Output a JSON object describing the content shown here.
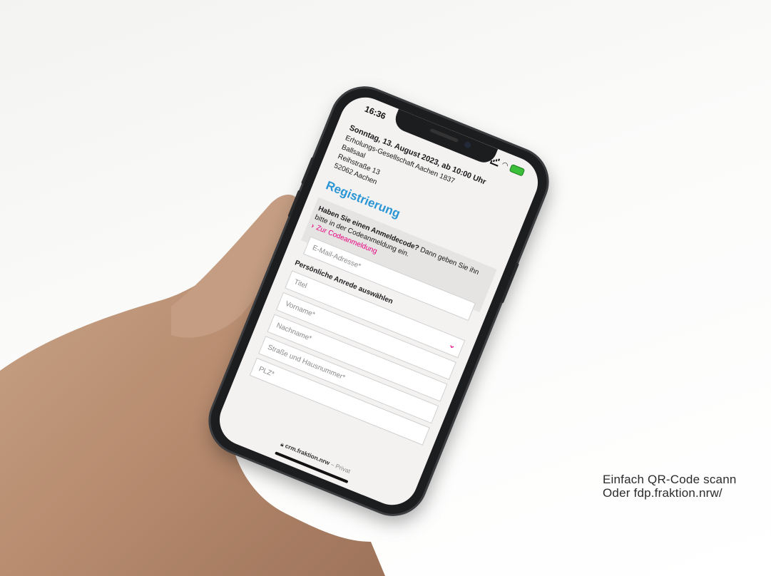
{
  "phone": {
    "status_time": "16:36",
    "event": {
      "date": "Sonntag, 13. August 2023, ab 10:00 Uhr",
      "venue": "Erholungs-Gesellschaft Aachen 1837",
      "room": "Ballsaal",
      "street": "Reihstraße 13",
      "city": "52062 Aachen"
    },
    "registration_title": "Registrierung",
    "code_box": {
      "bold_question": "Haben Sie einen Anmeldecode?",
      "text": " Dann geben Sie ihn bitte in der Codeanmeldung ein.",
      "link": "Zur Codeanmeldung"
    },
    "form": {
      "email_placeholder": "E-Mail-Adresse*",
      "salutation_label": "Persönliche Anrede auswählen",
      "title_placeholder": "Titel",
      "firstname_placeholder": "Vorname*",
      "lastname_placeholder": "Nachname*",
      "street_placeholder": "Straße und Hausnummer*",
      "zip_placeholder": "PLZ*"
    },
    "url_bar": {
      "domain": "crm.fraktion.nrw",
      "suffix": "– Privat"
    }
  },
  "caption": {
    "line1": "Einfach QR-Code scann",
    "line2": "Oder fdp.fraktion.nrw/"
  },
  "colors": {
    "accent_blue": "#2a95d5",
    "accent_magenta": "#e6007e"
  }
}
